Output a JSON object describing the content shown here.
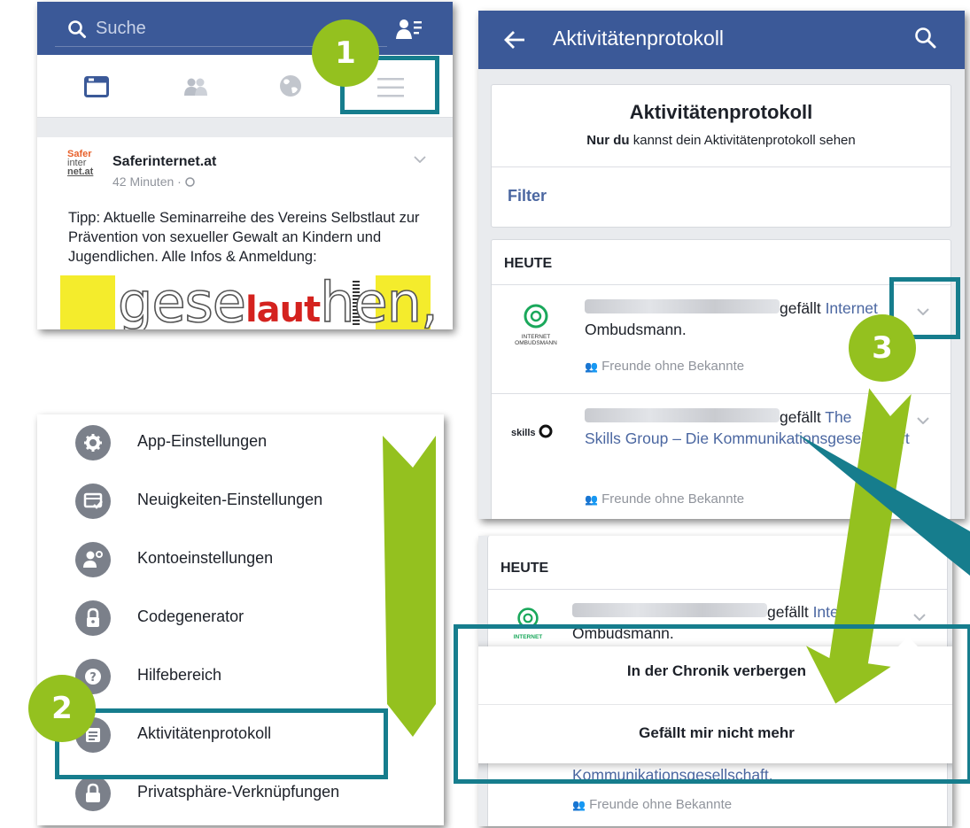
{
  "panel_newsfeed": {
    "search_placeholder": "Suche",
    "post": {
      "page_name": "Saferinternet.at",
      "time": "42 Minuten ·",
      "logo_line1": "Safer",
      "logo_line2": "inter",
      "logo_line3": "net.at",
      "text": "Tipp: Aktuelle Seminarreihe des Vereins Selbstlaut zur Prävention von sexueller Gewalt an Kindern und Jugendlichen. Alle Infos & Anmeldung:",
      "image_text_gese": "gese",
      "image_text_laut": "laut",
      "image_text_hen": "hen,"
    }
  },
  "panel_menu": {
    "items": [
      {
        "label": "App-Einstellungen"
      },
      {
        "label": "Neuigkeiten-Einstellungen"
      },
      {
        "label": "Kontoeinstellungen"
      },
      {
        "label": "Codegenerator"
      },
      {
        "label": "Hilfebereich"
      },
      {
        "label": "Aktivitätenprotokoll"
      },
      {
        "label": "Privatsphäre-Verknüpfungen"
      }
    ]
  },
  "panel_activity": {
    "header_title": "Aktivitätenprotokoll",
    "card_title": "Aktivitätenprotokoll",
    "card_subtitle_bold": "Nur du",
    "card_subtitle_rest": " kannst dein Aktivitätenprotokoll sehen",
    "filter_label": "Filter",
    "section_label": "HEUTE",
    "entries": [
      {
        "verb": "gefällt ",
        "page": "Internet",
        "page_cont": "Ombudsmann.",
        "audience": "Freunde ohne Bekannte",
        "logo_text": "INTERNET OMBUDSMANN"
      },
      {
        "verb": "gefällt ",
        "page": "The",
        "page_cont": "Skills Group – Die Kommunikationsgesellschaft",
        "audience": "Freunde ohne Bekannte",
        "logo_text": "skills"
      }
    ]
  },
  "panel_popup": {
    "section_label": "HEUTE",
    "entry_verb": "gefällt ",
    "entry_page": "Inter",
    "entry_page_cont": "Ombudsmann.",
    "logo_text": "INTERNET",
    "menu_options": [
      "In der Chronik verbergen",
      "Gefällt mir nicht mehr"
    ],
    "behind_text": "Kommunikationsgesellschaft.",
    "audience": "Freunde ohne Bekannte"
  },
  "callouts": [
    "1",
    "2",
    "3"
  ],
  "colors": {
    "facebook_blue": "#3b5998",
    "callout_green": "#94c11f",
    "highlight_teal": "#167d8d",
    "link_blue": "#4b67a1"
  }
}
